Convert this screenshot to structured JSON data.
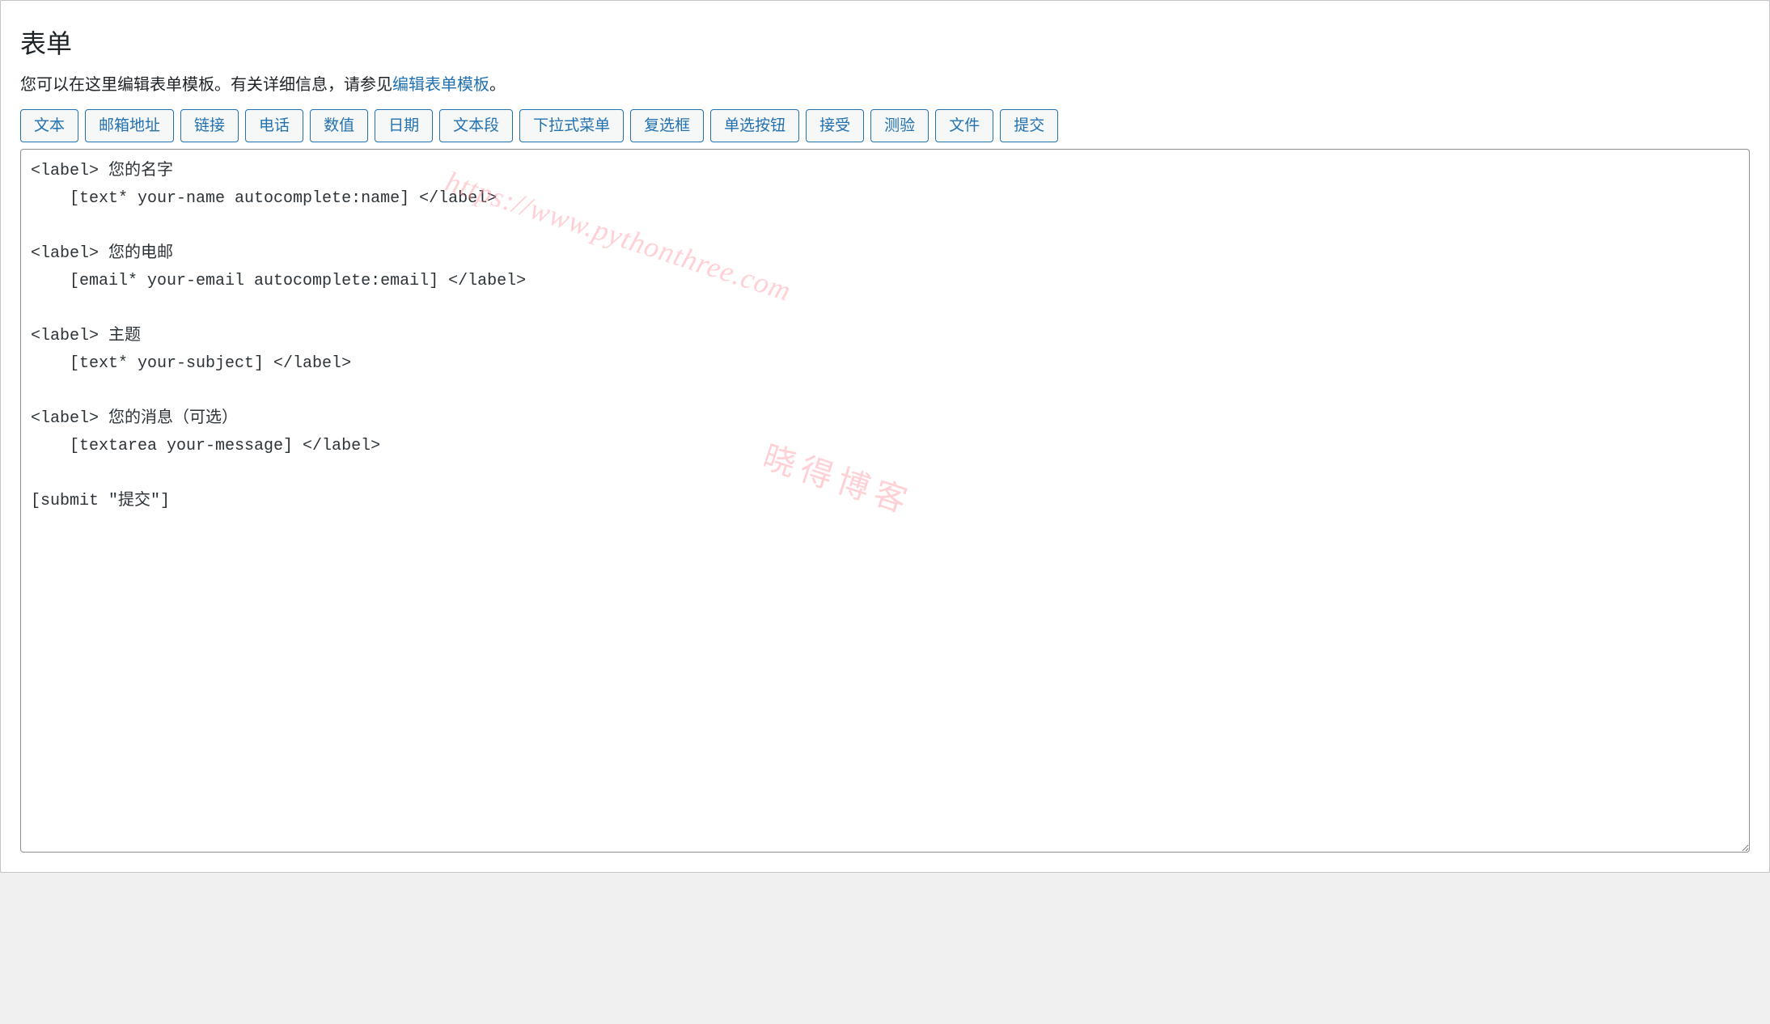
{
  "panel": {
    "heading": "表单",
    "description_prefix": "您可以在这里编辑表单模板。有关详细信息，请参见",
    "description_link": "编辑表单模板",
    "description_suffix": "。"
  },
  "tag_buttons": [
    "文本",
    "邮箱地址",
    "链接",
    "电话",
    "数值",
    "日期",
    "文本段",
    "下拉式菜单",
    "复选框",
    "单选按钮",
    "接受",
    "测验",
    "文件",
    "提交"
  ],
  "form_template": "<label> 您的名字\n    [text* your-name autocomplete:name] </label>\n\n<label> 您的电邮\n    [email* your-email autocomplete:email] </label>\n\n<label> 主题\n    [text* your-subject] </label>\n\n<label> 您的消息（可选）\n    [textarea your-message] </label>\n\n[submit \"提交\"]",
  "watermark": {
    "url": "https://www.pythonthree.com",
    "text": "晓得博客"
  }
}
